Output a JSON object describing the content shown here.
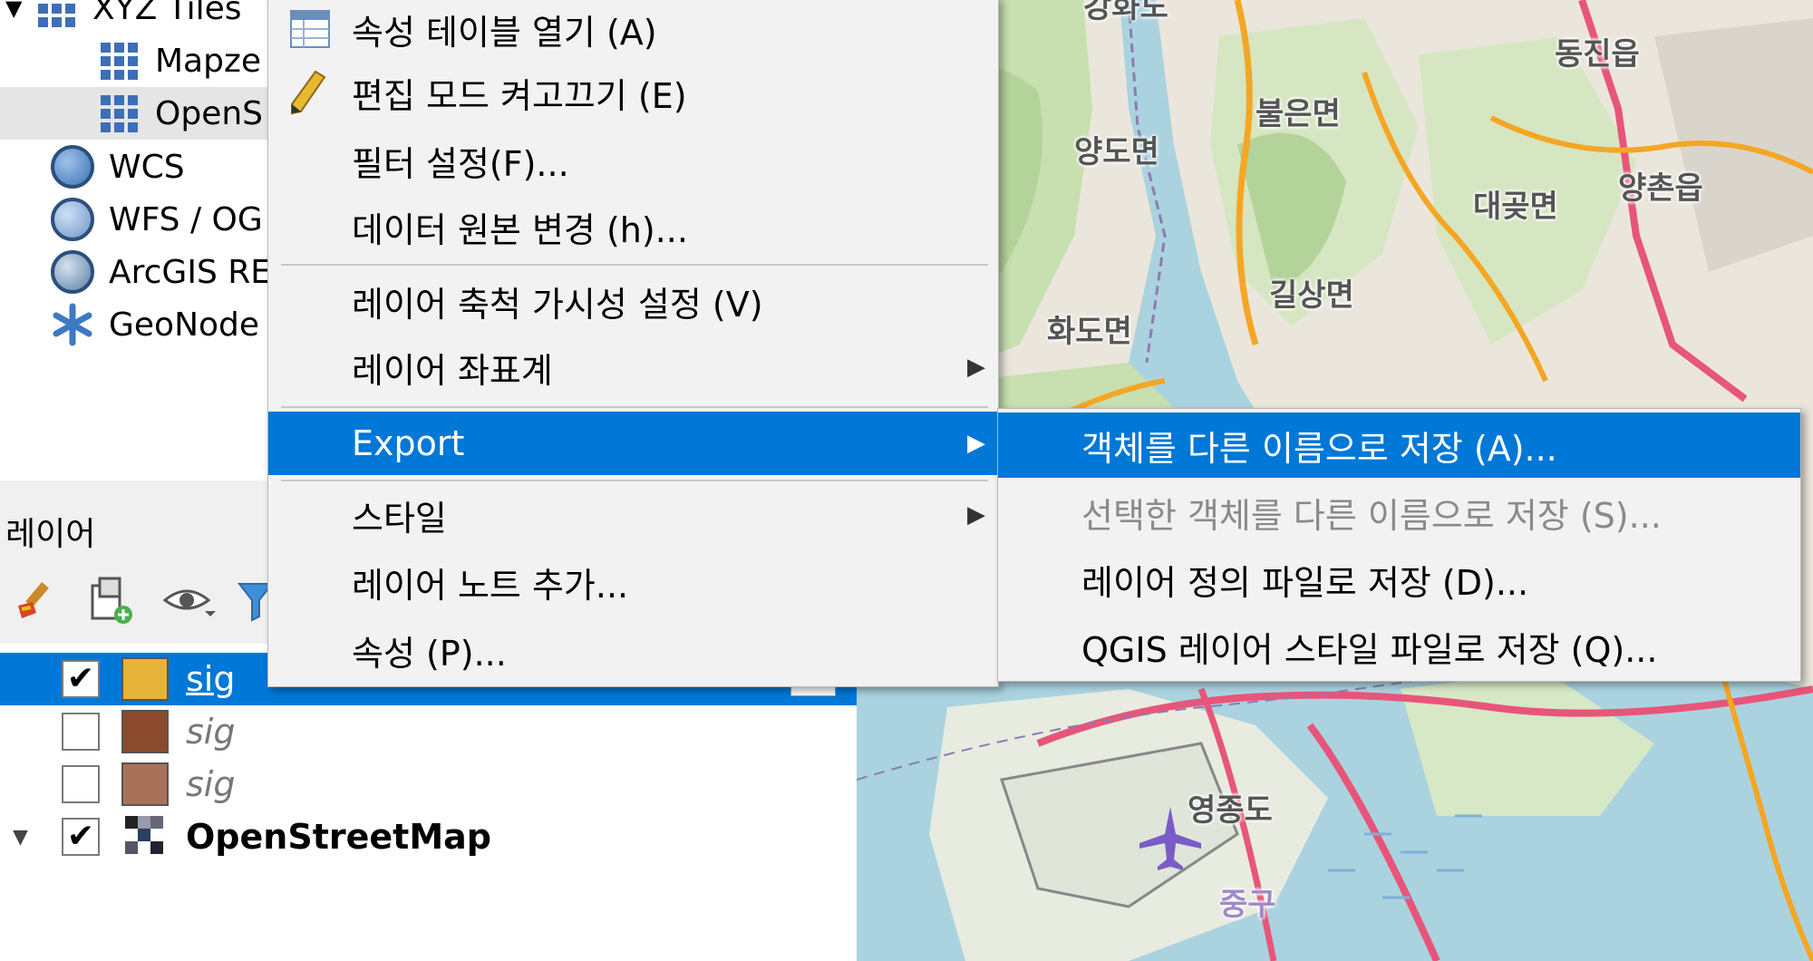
{
  "browser": {
    "items": [
      {
        "label": "XYZ Tiles",
        "icon": "xyz-tiles-icon",
        "expanded": true
      },
      {
        "label": "Mapze",
        "icon": "tile-grid-icon"
      },
      {
        "label": "OpenS",
        "icon": "tile-grid-icon"
      },
      {
        "label": "WCS",
        "icon": "wcs-globe-icon"
      },
      {
        "label": "WFS / OG",
        "icon": "wfs-globe-icon"
      },
      {
        "label": "ArcGIS RE",
        "icon": "arcgis-globe-icon"
      },
      {
        "label": "GeoNode",
        "icon": "geonode-icon"
      }
    ]
  },
  "layers": {
    "title": "레이어",
    "rows": [
      {
        "name": "sig",
        "checked": true,
        "selected": true,
        "color": "#e6b33a"
      },
      {
        "name": "sig",
        "checked": false,
        "selected": false,
        "color": "#8b4a2b"
      },
      {
        "name": "sig",
        "checked": false,
        "selected": false,
        "color": "#a8715a"
      },
      {
        "name": "OpenStreetMap",
        "checked": true,
        "selected": false,
        "group": true
      }
    ],
    "check_mark": "✔"
  },
  "context_menu": {
    "items": [
      {
        "label": "속성 테이블 열기 (A)",
        "icon": "attribute-table-icon"
      },
      {
        "label": "편집 모드 켜고끄기 (E)",
        "icon": "pencil-icon"
      },
      {
        "label": "필터 설정(F)..."
      },
      {
        "label": "데이터 원본 변경 (h)..."
      },
      {
        "label": "레이어 축척 가시성 설정 (V)"
      },
      {
        "label": "레이어 좌표계",
        "submenu": true
      },
      {
        "label": "Export",
        "submenu": true,
        "selected": true
      },
      {
        "label": "스타일",
        "submenu": true
      },
      {
        "label": "레이어 노트 추가..."
      },
      {
        "label": "속성 (P)..."
      }
    ]
  },
  "export_submenu": {
    "items": [
      {
        "label": "객체를 다른 이름으로 저장 (A)...",
        "selected": true
      },
      {
        "label": "선택한 객체를 다른 이름으로 저장 (S)...",
        "disabled": true
      },
      {
        "label": "레이어 정의 파일로 저장 (D)..."
      },
      {
        "label": "QGIS 레이어 스타일 파일로 저장 (Q)..."
      }
    ]
  },
  "map": {
    "places": [
      "강화도",
      "동진읍",
      "불은면",
      "양도면",
      "대곶면",
      "양촌읍",
      "길상면",
      "화도면",
      "영종도",
      "중구"
    ]
  },
  "colors": {
    "selection": "#0078d7",
    "menu_bg": "#f2f2f2",
    "sea": "#aad3df",
    "land": "#eae6dc",
    "forest": "#c8dfb0"
  }
}
